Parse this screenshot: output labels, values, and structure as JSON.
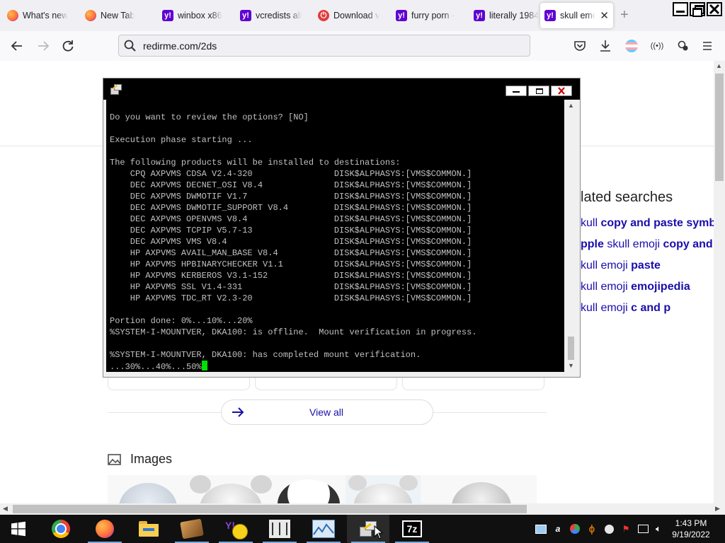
{
  "browser": {
    "tabs": [
      {
        "label": "What's new",
        "icon": "firefox-icon",
        "active": false
      },
      {
        "label": "New Tab",
        "icon": "firefox-icon",
        "active": false
      },
      {
        "label": "winbox x86",
        "icon": "yahoo-icon",
        "active": false
      },
      {
        "label": "vcredists all",
        "icon": "yahoo-icon",
        "active": false
      },
      {
        "label": "Download v",
        "icon": "download-site-icon",
        "active": false
      },
      {
        "label": "furry porn -",
        "icon": "yahoo-icon",
        "active": false
      },
      {
        "label": "literally 1984",
        "icon": "yahoo-icon",
        "active": false
      },
      {
        "label": "skull emo",
        "icon": "yahoo-icon",
        "active": true
      }
    ],
    "url": "redirme.com/2ds",
    "accent": "#6001d2"
  },
  "webpage": {
    "related_title": "lated searches",
    "related_items": [
      {
        "parts": [
          {
            "t": "kull ",
            "b": false
          },
          {
            "t": "copy and paste symb",
            "b": true
          }
        ]
      },
      {
        "parts": [
          {
            "t": "pple",
            "b": true
          },
          {
            "t": " skull emoji ",
            "b": false
          },
          {
            "t": "copy and",
            "b": true
          }
        ]
      },
      {
        "parts": [
          {
            "t": "kull emoji ",
            "b": false
          },
          {
            "t": "paste",
            "b": true
          }
        ]
      },
      {
        "parts": [
          {
            "t": "kull emoji ",
            "b": false
          },
          {
            "t": "emojipedia",
            "b": true
          }
        ]
      },
      {
        "parts": [
          {
            "t": "kull emoji ",
            "b": false
          },
          {
            "t": "c and p",
            "b": true
          }
        ]
      }
    ],
    "view_all": "View all",
    "images_heading": "Images",
    "link_color": "#1a0dab"
  },
  "putty": {
    "terminal_lines": [
      "Do you want to review the options? [NO]",
      "",
      "Execution phase starting ...",
      "",
      "The following products will be installed to destinations:",
      "    CPQ AXPVMS CDSA V2.4-320                DISK$ALPHASYS:[VMS$COMMON.]",
      "    DEC AXPVMS DECNET_OSI V8.4              DISK$ALPHASYS:[VMS$COMMON.]",
      "    DEC AXPVMS DWMOTIF V1.7                 DISK$ALPHASYS:[VMS$COMMON.]",
      "    DEC AXPVMS DWMOTIF_SUPPORT V8.4         DISK$ALPHASYS:[VMS$COMMON.]",
      "    DEC AXPVMS OPENVMS V8.4                 DISK$ALPHASYS:[VMS$COMMON.]",
      "    DEC AXPVMS TCPIP V5.7-13                DISK$ALPHASYS:[VMS$COMMON.]",
      "    DEC AXPVMS VMS V8.4                     DISK$ALPHASYS:[VMS$COMMON.]",
      "    HP AXPVMS AVAIL_MAN_BASE V8.4           DISK$ALPHASYS:[VMS$COMMON.]",
      "    HP AXPVMS HPBINARYCHECKER V1.1          DISK$ALPHASYS:[VMS$COMMON.]",
      "    HP AXPVMS KERBEROS V3.1-152             DISK$ALPHASYS:[VMS$COMMON.]",
      "    HP AXPVMS SSL V1.4-331                  DISK$ALPHASYS:[VMS$COMMON.]",
      "    HP AXPVMS TDC_RT V2.3-20                DISK$ALPHASYS:[VMS$COMMON.]",
      "",
      "Portion done: 0%...10%...20%",
      "%SYSTEM-I-MOUNTVER, DKA100: is offline.  Mount verification in progress.",
      "",
      "%SYSTEM-I-MOUNTVER, DKA100: has completed mount verification.",
      "...30%...40%...50%"
    ],
    "cursor_color": "#00e000",
    "text_color": "#c0c0c0"
  },
  "taskbar": {
    "apps": [
      {
        "icon": "windows-start-icon"
      },
      {
        "icon": "chrome-icon"
      },
      {
        "icon": "firefox-icon"
      },
      {
        "icon": "file-explorer-icon"
      },
      {
        "icon": "media-app-icon"
      },
      {
        "icon": "yahoo-messenger-icon"
      },
      {
        "icon": "mixer-icon"
      },
      {
        "icon": "monitor-icon"
      },
      {
        "icon": "putty-icon"
      },
      {
        "icon": "7zip-icon"
      }
    ],
    "sevenzip_label": "7z",
    "clock_time": "1:43 PM",
    "clock_date": "9/19/2022"
  }
}
